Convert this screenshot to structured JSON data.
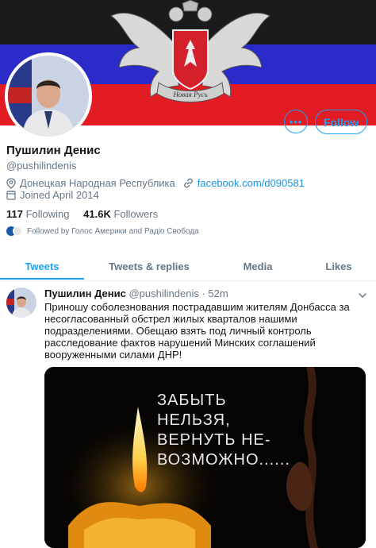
{
  "profile": {
    "name": "Пушилин Денис",
    "handle": "@pushilindenis",
    "location": "Донецкая Народная Республика",
    "website": "facebook.com/d090581",
    "joined": "Joined April 2014",
    "following_count": "117",
    "following_label": "Following",
    "followers_count": "41.6K",
    "followers_label": "Followers",
    "followed_by": "Followed by Голос Америки and Радіо Свобода",
    "banner_motto": "Новая Русь"
  },
  "actions": {
    "more_label": "•••",
    "follow_label": "Follow"
  },
  "tabs": [
    {
      "label": "Tweets",
      "active": true
    },
    {
      "label": "Tweets & replies",
      "active": false
    },
    {
      "label": "Media",
      "active": false
    },
    {
      "label": "Likes",
      "active": false
    }
  ],
  "tweet": {
    "author": "Пушилин Денис",
    "handle": "@pushilindenis",
    "separator": "·",
    "time": "52m",
    "text_lines": [
      "Приношу соболезнования пострадавшим жителям Донбасса за",
      "несогласованный обстрел жилых кварталов нашими",
      "подразделениями. Обещаю взять под личный контроль",
      "расследование фактов нарушений Минских соглашений",
      "вооруженными силами ДНР!"
    ],
    "media_lines": [
      "ЗАБЫТЬ",
      "НЕЛЬЗЯ,",
      "ВЕРНУТЬ НЕ-",
      "ВОЗМОЖНО......"
    ]
  },
  "colors": {
    "accent": "#1da1f2",
    "link": "#1b95e0",
    "muted": "#657786",
    "text": "#14171a"
  }
}
